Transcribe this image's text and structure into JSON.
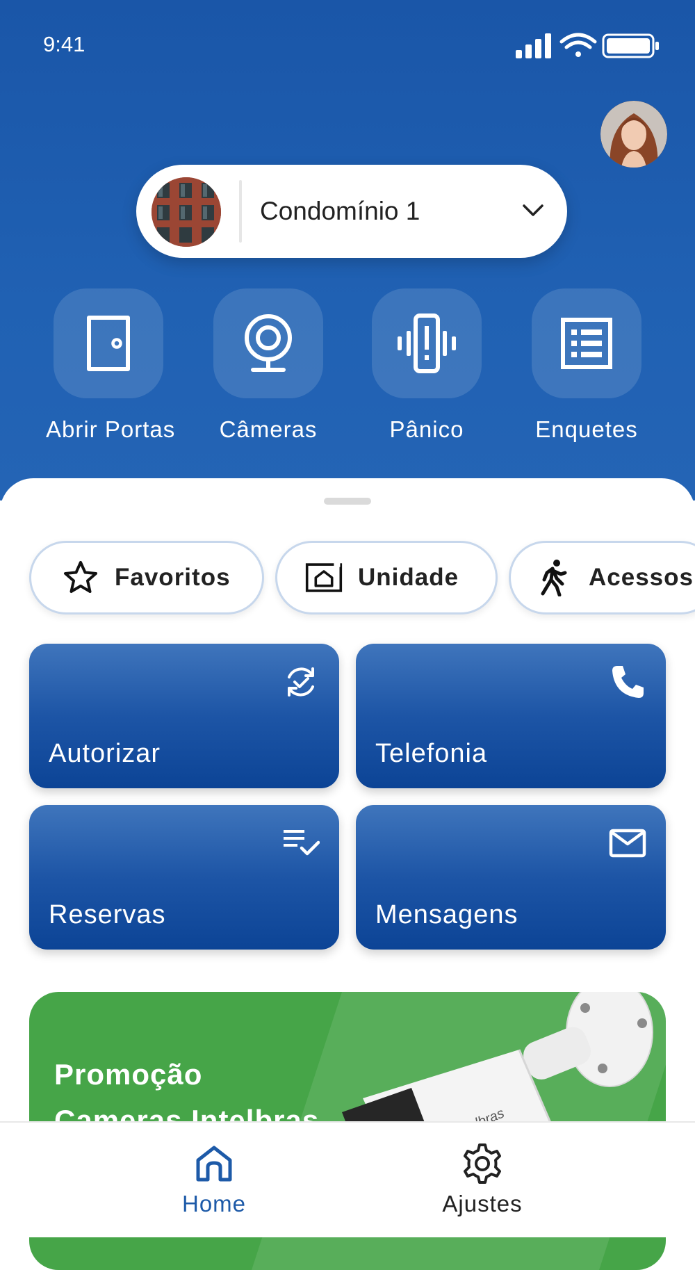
{
  "status_bar": {
    "time": "9:41",
    "icons": [
      "signal-icon",
      "wifi-icon",
      "battery-icon"
    ]
  },
  "header": {
    "condominium": {
      "name": "Condomínio 1"
    }
  },
  "quick_actions": [
    {
      "label": "Abrir Portas",
      "icon": "door-icon"
    },
    {
      "label": "Câmeras",
      "icon": "webcam-icon"
    },
    {
      "label": "Pânico",
      "icon": "panic-phone-icon"
    },
    {
      "label": "Enquetes",
      "icon": "list-icon"
    }
  ],
  "chips": [
    {
      "label": "Favoritos",
      "icon": "star-icon"
    },
    {
      "label": "Unidade",
      "icon": "home-screen-icon"
    },
    {
      "label": "Acessos",
      "icon": "walking-icon"
    }
  ],
  "cards": [
    {
      "label": "Autorizar",
      "icon": "sync-check-icon"
    },
    {
      "label": "Telefonia",
      "icon": "phone-icon"
    },
    {
      "label": "Reservas",
      "icon": "checklist-icon"
    },
    {
      "label": "Mensagens",
      "icon": "mail-icon"
    }
  ],
  "promo": {
    "line1": "Promoção",
    "line2": "Cameras Intelbras",
    "camera_brand": "intelbras"
  },
  "tab_bar": {
    "active": "Home",
    "tabs": [
      {
        "label": "Home",
        "icon": "home-icon"
      },
      {
        "label": "Ajustes",
        "icon": "gear-icon"
      }
    ]
  },
  "colors": {
    "header_blue": "#1a56a8",
    "card_blue": "#0c4496",
    "promo_green": "#46a548",
    "active_tab": "#1d5aa8"
  }
}
